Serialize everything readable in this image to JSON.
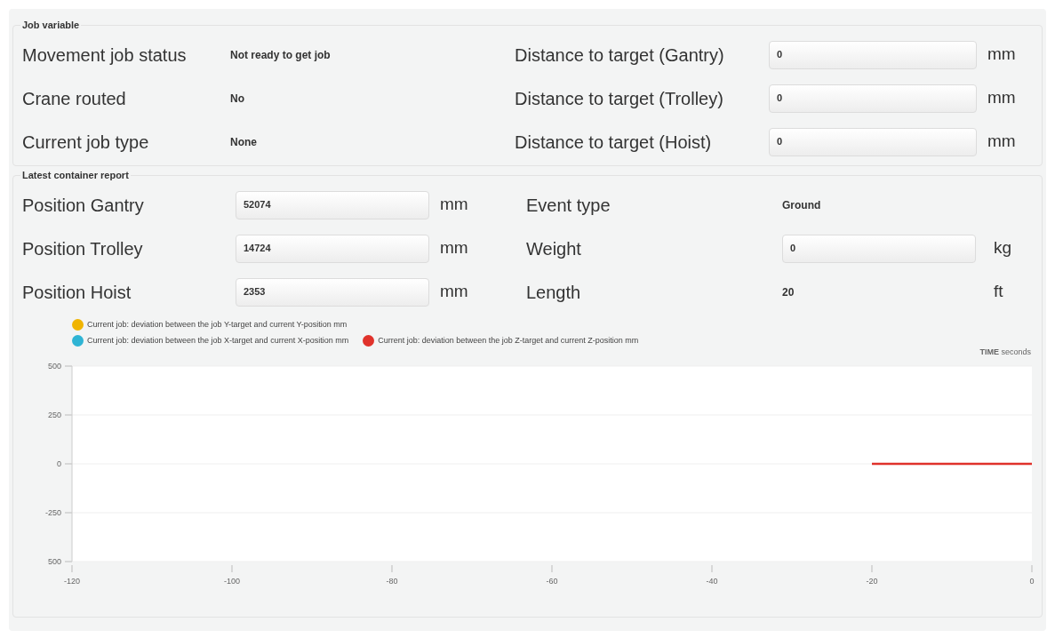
{
  "job_variable": {
    "title": "Job variable",
    "left": [
      {
        "label": "Movement job status",
        "kind": "value",
        "value": "Not ready to get job"
      },
      {
        "label": "Crane routed",
        "kind": "value",
        "value": "No"
      },
      {
        "label": "Current job type",
        "kind": "value",
        "value": "None"
      }
    ],
    "right": [
      {
        "label": "Distance to target (Gantry)",
        "kind": "input",
        "value": "0",
        "unit": "mm"
      },
      {
        "label": "Distance to target (Trolley)",
        "kind": "input",
        "value": "0",
        "unit": "mm"
      },
      {
        "label": "Distance to target (Hoist)",
        "kind": "input",
        "value": "0",
        "unit": "mm"
      }
    ]
  },
  "container_report": {
    "title": "Latest container report",
    "left": [
      {
        "label": "Position Gantry",
        "kind": "input",
        "value": "52074",
        "unit": "mm"
      },
      {
        "label": "Position Trolley",
        "kind": "input",
        "value": "14724",
        "unit": "mm"
      },
      {
        "label": "Position Hoist",
        "kind": "input",
        "value": "2353",
        "unit": "mm"
      }
    ],
    "right": [
      {
        "label": "Event type",
        "kind": "value",
        "value": "Ground"
      },
      {
        "label": "Weight",
        "kind": "input",
        "value": "0",
        "unit": "kg"
      },
      {
        "label": "Length",
        "kind": "value",
        "value": "20",
        "unit": "ft"
      }
    ],
    "chart_data": {
      "type": "line",
      "grid": true,
      "xlabel": "**TIME** seconds",
      "x": [
        -20,
        0
      ],
      "xlim": [
        -120,
        0
      ],
      "ylim": [
        -500,
        500
      ],
      "xticks": [
        -120,
        -100,
        -80,
        -60,
        -40,
        -20,
        0
      ],
      "yticks": [
        500,
        250,
        0,
        -250,
        {
          "value": -500,
          "label": "500"
        }
      ],
      "series": [
        {
          "name": "Current job: deviation between the job Y-target and current Y-position mm",
          "color": "#f0b400",
          "values": [
            null,
            null
          ]
        },
        {
          "name": "Current job: deviation between the job X-target and current X-position mm",
          "color": "#2fb4d4",
          "values": [
            null,
            null
          ]
        },
        {
          "name": "Current job: deviation between the job Z-target and current Z-position mm",
          "color": "#e0322b",
          "values": [
            0,
            0
          ]
        }
      ]
    }
  }
}
